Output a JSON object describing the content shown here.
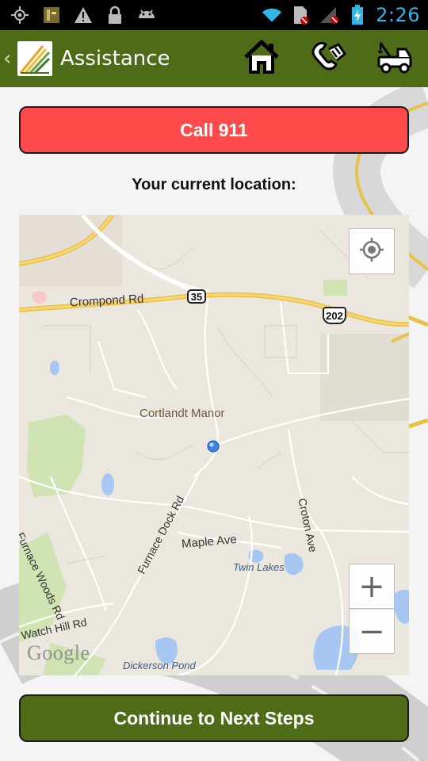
{
  "status_bar": {
    "time": "2:26",
    "icons": [
      "gps-icon",
      "notification-image-icon",
      "warning-icon",
      "lock-icon",
      "android-icon",
      "wifi-icon",
      "sim-icon",
      "signal-icon",
      "battery-icon"
    ],
    "time_color": "#33b5e5"
  },
  "action_bar": {
    "title": "Assistance",
    "background": "#4e6b18",
    "actions": [
      "home-icon",
      "phone-hands-icon",
      "tow-truck-icon"
    ]
  },
  "call_button": {
    "label": "Call 911",
    "color": "#ff4b4b"
  },
  "location_label": "Your current location:",
  "map": {
    "place_labels": {
      "crompond": "Crompond Rd",
      "cortlandt": "Cortlandt Manor",
      "furnace_woods": "Furnace Woods Rd",
      "furnace_dock": "Furnace Dock Rd",
      "maple": "Maple Ave",
      "croton": "Croton Ave",
      "twin_lakes": "Twin Lakes",
      "watch_hill": "Watch Hill Rd",
      "dickerson": "Dickerson Pond"
    },
    "shields": {
      "route35": "35",
      "route202": "202"
    },
    "attribution": "Google",
    "zoom_in": "+",
    "zoom_out": "−"
  },
  "next_button": {
    "label": "Continue to Next Steps",
    "color": "#4e6b18"
  }
}
